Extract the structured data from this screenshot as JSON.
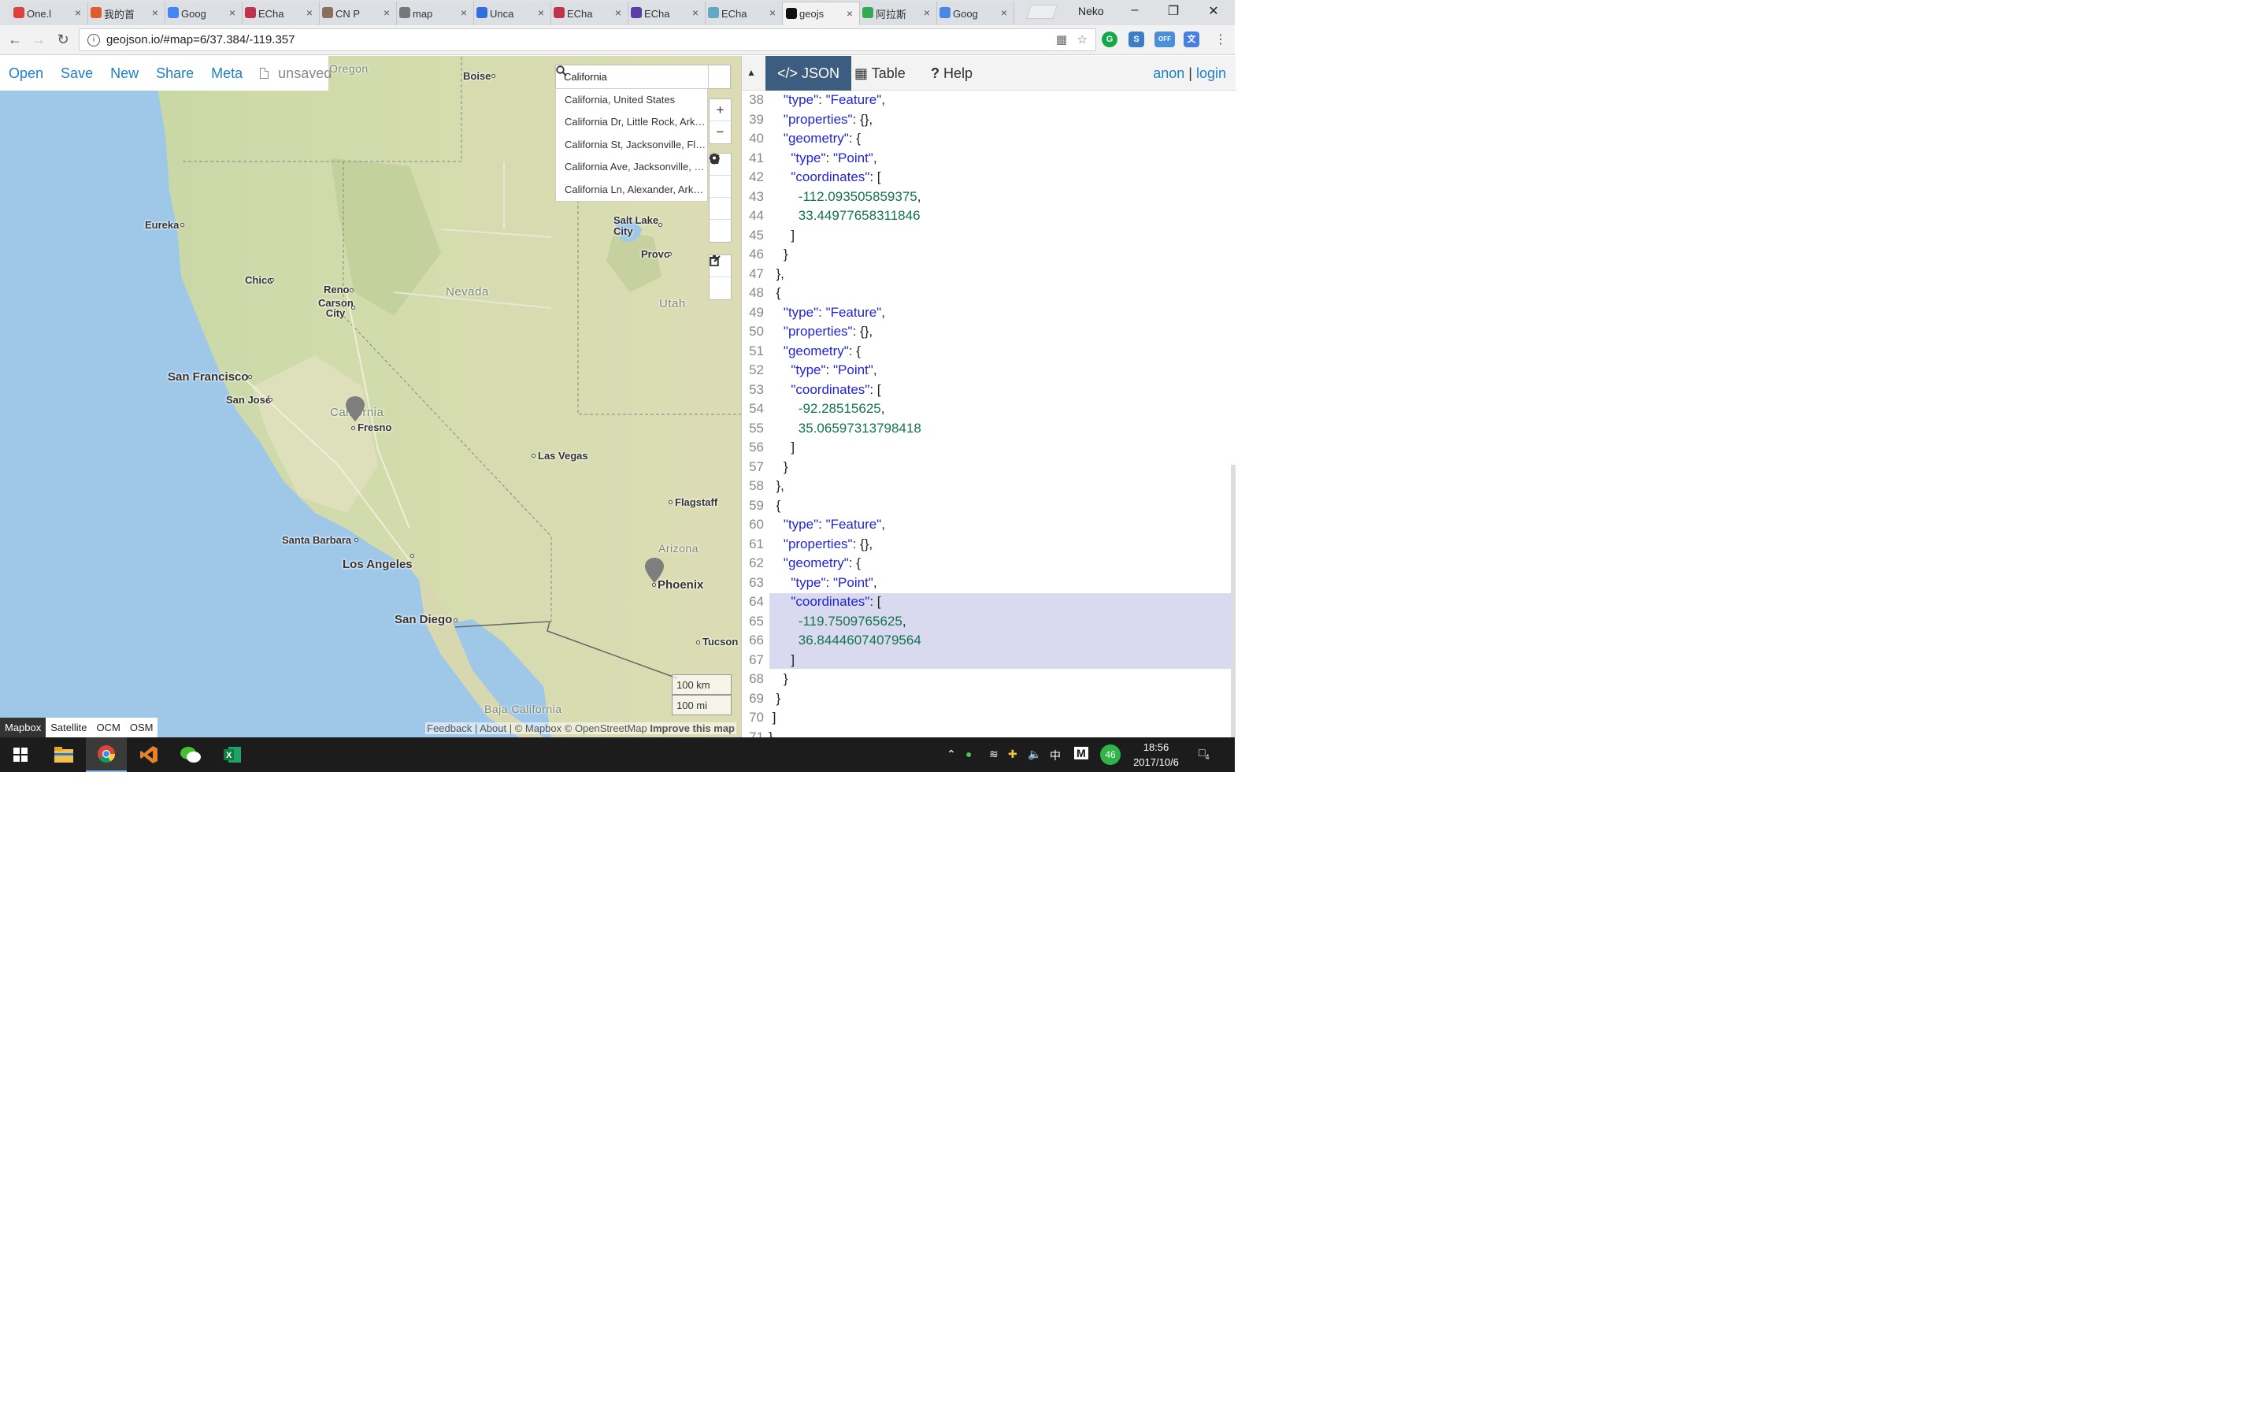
{
  "browser": {
    "tabs": [
      {
        "label": "One.l",
        "color": "#e0403a"
      },
      {
        "label": "我的首",
        "color": "#e05a2b"
      },
      {
        "label": "Goog",
        "color": "#4285f4"
      },
      {
        "label": "ECha",
        "color": "#c2324b"
      },
      {
        "label": "CN P",
        "color": "#8c6f5a"
      },
      {
        "label": "map",
        "color": "#777777"
      },
      {
        "label": "Unca",
        "color": "#2f6fe0"
      },
      {
        "label": "ECha",
        "color": "#c2324b"
      },
      {
        "label": "ECha",
        "color": "#5a3fa8"
      },
      {
        "label": "ECha",
        "color": "#5fa9c5"
      },
      {
        "label": "geojs",
        "color": "#111111"
      },
      {
        "label": "阿拉斯",
        "color": "#34a853"
      },
      {
        "label": "Goog",
        "color": "#4a86e8"
      }
    ],
    "active_tab": 10,
    "profile": "Neko",
    "url": "geojson.io/#map=6/37.384/-119.357"
  },
  "app": {
    "menu": [
      "Open",
      "Save",
      "New",
      "Share",
      "Meta"
    ],
    "status": "unsaved",
    "search": {
      "value": "California",
      "suggestions": [
        "California, United States",
        "California Dr, Little Rock, Arkansas",
        "California St, Jacksonville, Florida",
        "California Ave, Jacksonville, Florida",
        "California Ln, Alexander, Arkansas"
      ]
    },
    "map_labels": {
      "cities": [
        "Boise",
        "Eureka",
        "Salt Lake City",
        "Provo",
        "Chico",
        "Reno",
        "Carson City",
        "San Francisco",
        "San José",
        "Fresno",
        "Las Vegas",
        "Flagstaff",
        "Santa Barbara",
        "Los Angeles",
        "Phoenix",
        "San Diego",
        "Tucson"
      ],
      "states": [
        "Oregon",
        "Nevada",
        "Utah",
        "California",
        "Arizona",
        "Baja California"
      ]
    },
    "layers": [
      "Mapbox",
      "Satellite",
      "OCM",
      "OSM"
    ],
    "active_layer": "Mapbox",
    "scale": [
      "100 km",
      "100 mi"
    ],
    "attribution": {
      "feedback": "Feedback",
      "about": "About",
      "credits": "© Mapbox © OpenStreetMap",
      "improve": "Improve this map"
    },
    "pane_tabs": [
      "JSON",
      "Table",
      "Help"
    ],
    "active_pane_tab": "JSON",
    "auth": {
      "user": "anon",
      "login": "login"
    },
    "code_lines": [
      {
        "n": "38",
        "t": "    \"type\": \"Feature\","
      },
      {
        "n": "39",
        "t": "    \"properties\": {},"
      },
      {
        "n": "40",
        "t": "    \"geometry\": {"
      },
      {
        "n": "41",
        "t": "      \"type\": \"Point\","
      },
      {
        "n": "42",
        "t": "      \"coordinates\": ["
      },
      {
        "n": "43",
        "t": "        -112.093505859375,"
      },
      {
        "n": "44",
        "t": "        33.44977658311846"
      },
      {
        "n": "45",
        "t": "      ]"
      },
      {
        "n": "46",
        "t": "    }"
      },
      {
        "n": "47",
        "t": "  },"
      },
      {
        "n": "48",
        "t": "  {"
      },
      {
        "n": "49",
        "t": "    \"type\": \"Feature\","
      },
      {
        "n": "50",
        "t": "    \"properties\": {},"
      },
      {
        "n": "51",
        "t": "    \"geometry\": {"
      },
      {
        "n": "52",
        "t": "      \"type\": \"Point\","
      },
      {
        "n": "53",
        "t": "      \"coordinates\": ["
      },
      {
        "n": "54",
        "t": "        -92.28515625,"
      },
      {
        "n": "55",
        "t": "        35.06597313798418"
      },
      {
        "n": "56",
        "t": "      ]"
      },
      {
        "n": "57",
        "t": "    }"
      },
      {
        "n": "58",
        "t": "  },"
      },
      {
        "n": "59",
        "t": "  {"
      },
      {
        "n": "60",
        "t": "    \"type\": \"Feature\","
      },
      {
        "n": "61",
        "t": "    \"properties\": {},"
      },
      {
        "n": "62",
        "t": "    \"geometry\": {"
      },
      {
        "n": "63",
        "t": "      \"type\": \"Point\","
      },
      {
        "n": "64",
        "t": "      \"coordinates\": ["
      },
      {
        "n": "65",
        "t": "        -119.7509765625,"
      },
      {
        "n": "66",
        "t": "        36.84446074079564"
      },
      {
        "n": "67",
        "t": "      ]"
      },
      {
        "n": "68",
        "t": "    }"
      },
      {
        "n": "69",
        "t": "  }"
      },
      {
        "n": "70",
        "t": " ]"
      },
      {
        "n": "71",
        "t": "}"
      }
    ],
    "highlight_lines": [
      "64",
      "67"
    ]
  },
  "taskbar": {
    "clock_time": "18:56",
    "clock_date": "2017/10/6",
    "ime": "中",
    "ime_mode": "M",
    "badge": "46",
    "notifications": "4"
  },
  "colors": {
    "link": "#1d7fc5",
    "active_pane": "#3d5d80",
    "key": "#2323d4",
    "number": "#12744e"
  }
}
